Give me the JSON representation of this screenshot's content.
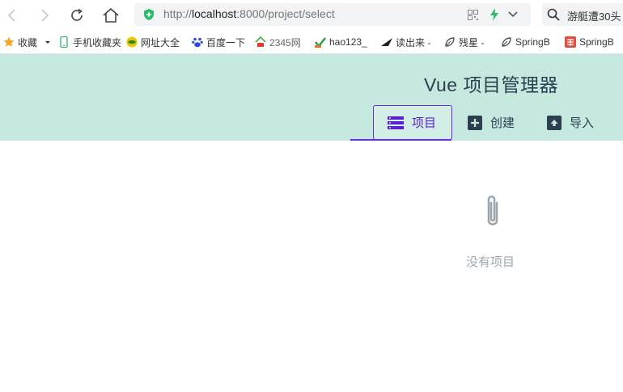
{
  "browser": {
    "url_prefix": "http://",
    "url_host": "localhost",
    "url_rest": ":8000/project/select",
    "search_text": "游艇遭30头"
  },
  "bookmarks": [
    {
      "label": "收藏",
      "icon": "star-icon"
    },
    {
      "label": "手机收藏夹",
      "icon": "phone-icon"
    },
    {
      "label": "网址大全",
      "icon": "globe-icon"
    },
    {
      "label": "百度一下",
      "icon": "baidu-paw-icon"
    },
    {
      "label": "2345网",
      "icon": "house-icon"
    },
    {
      "label": "hao123_",
      "icon": "hao123-icon"
    },
    {
      "label": "读出来 -",
      "icon": "wing-icon"
    },
    {
      "label": "残星 -",
      "icon": "leaf-icon"
    },
    {
      "label": "SpringB",
      "icon": "leaf-icon"
    },
    {
      "label": "SpringB",
      "icon": "jian-icon"
    }
  ],
  "app": {
    "title": "Vue 项目管理器",
    "tabs": [
      {
        "label": "项目",
        "icon": "list-icon",
        "active": true
      },
      {
        "label": "创建",
        "icon": "plus-box-icon",
        "active": false
      },
      {
        "label": "导入",
        "icon": "upload-box-icon",
        "active": false
      }
    ],
    "empty_text": "没有项目"
  },
  "colors": {
    "header_bg": "#c5e9de",
    "accent": "#6b2bd6",
    "title": "#2c3e50",
    "empty_text": "#9ea7ad"
  }
}
